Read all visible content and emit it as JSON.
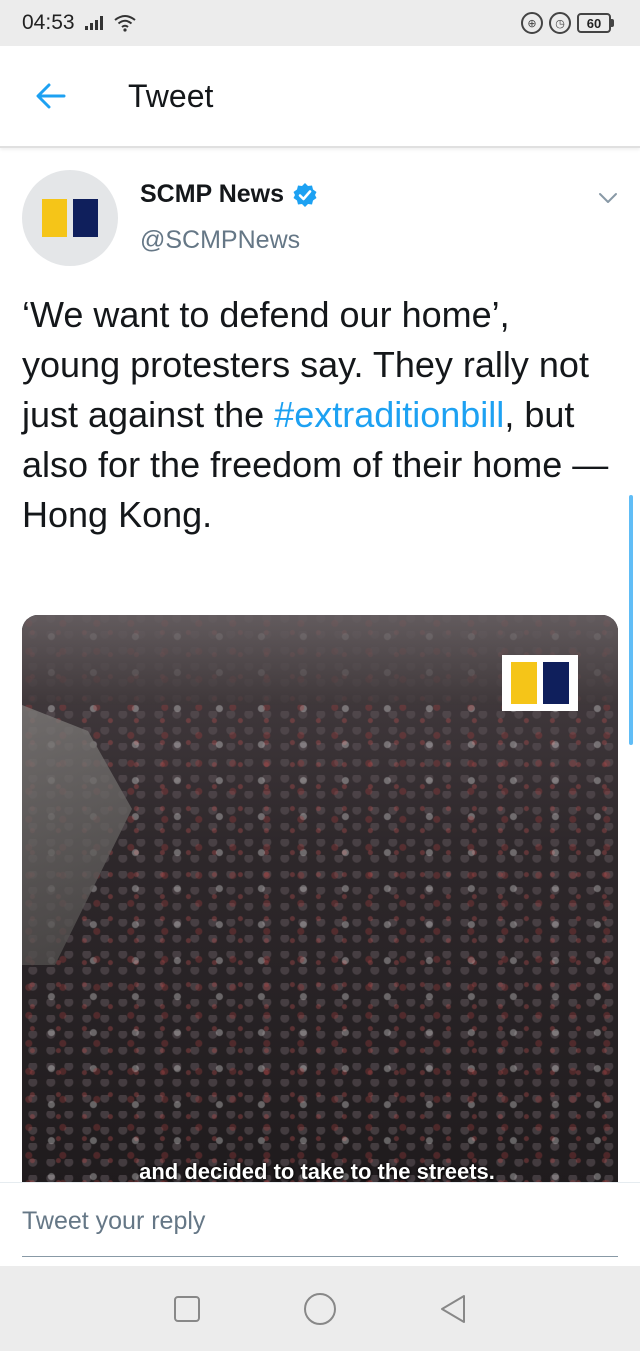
{
  "status_bar": {
    "time": "04:53",
    "battery": "60"
  },
  "header": {
    "title": "Tweet"
  },
  "tweet": {
    "author_name": "SCMP News",
    "handle": "@SCMPNews",
    "text_before": "‘We want to defend our home’, young protesters say. They rally not just against the ",
    "hashtag": "#extraditionbill",
    "text_after": ", but also for the freedom of their home — Hong Kong.",
    "media_caption": "and decided to take to the streets."
  },
  "reply": {
    "placeholder": "Tweet your reply"
  },
  "colors": {
    "accent": "#1da1f2",
    "brand_yellow": "#f5c518",
    "brand_navy": "#0f1f5c"
  },
  "icons": {
    "back": "arrow-left-icon",
    "verified": "verified-badge-icon",
    "caret": "chevron-down-icon",
    "nav_recent": "square-icon",
    "nav_home": "circle-icon",
    "nav_back": "triangle-back-icon"
  }
}
